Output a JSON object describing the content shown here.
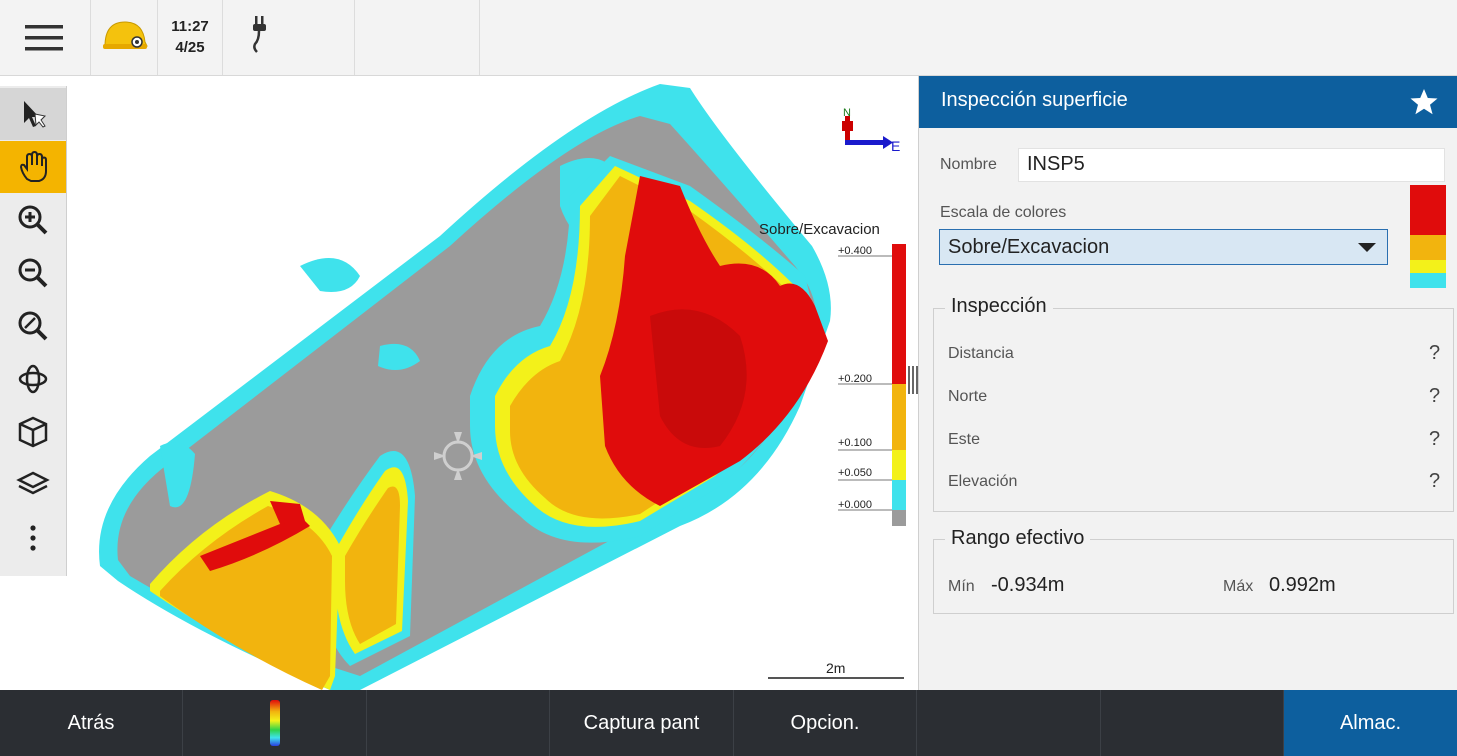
{
  "topbar": {
    "time": "11:27",
    "date": "4/25"
  },
  "icons": {
    "menu": "hamburger-menu-icon",
    "helmet": "helmet-icon",
    "connection": "plug-icon"
  },
  "map": {
    "north_label": "N",
    "east_label": "E",
    "legend_title": "Sobre/Excavacion",
    "legend_ticks": [
      "+0.400",
      "+0.200",
      "+0.100",
      "+0.050",
      "+0.000"
    ],
    "scale_label": "2m"
  },
  "panel": {
    "title": "Inspección superficie",
    "name_label": "Nombre",
    "name_value": "INSP5",
    "color_scale_label": "Escala de colores",
    "color_scale_value": "Sobre/Excavacion",
    "inspection_title": "Inspección",
    "rows": [
      {
        "label": "Distancia",
        "value": "?"
      },
      {
        "label": "Norte",
        "value": "?"
      },
      {
        "label": "Este",
        "value": "?"
      },
      {
        "label": "Elevación",
        "value": "?"
      }
    ],
    "range_title": "Rango efectivo",
    "min_label": "Mín",
    "min_value": "-0.934m",
    "max_label": "Máx",
    "max_value": "0.992m"
  },
  "bottombar": {
    "back": "Atrás",
    "screenshot": "Captura pant",
    "options": "Opcion.",
    "save": "Almac."
  },
  "colors": {
    "header_blue": "#0d5f9e",
    "red": "#e00c0c",
    "orange": "#f2b40e",
    "yellow": "#f3f11a",
    "cyan": "#3fe2ec",
    "gray": "#9b9b9b",
    "bottom_bar": "#2b2e33",
    "save_blue": "#0d5f9e"
  }
}
